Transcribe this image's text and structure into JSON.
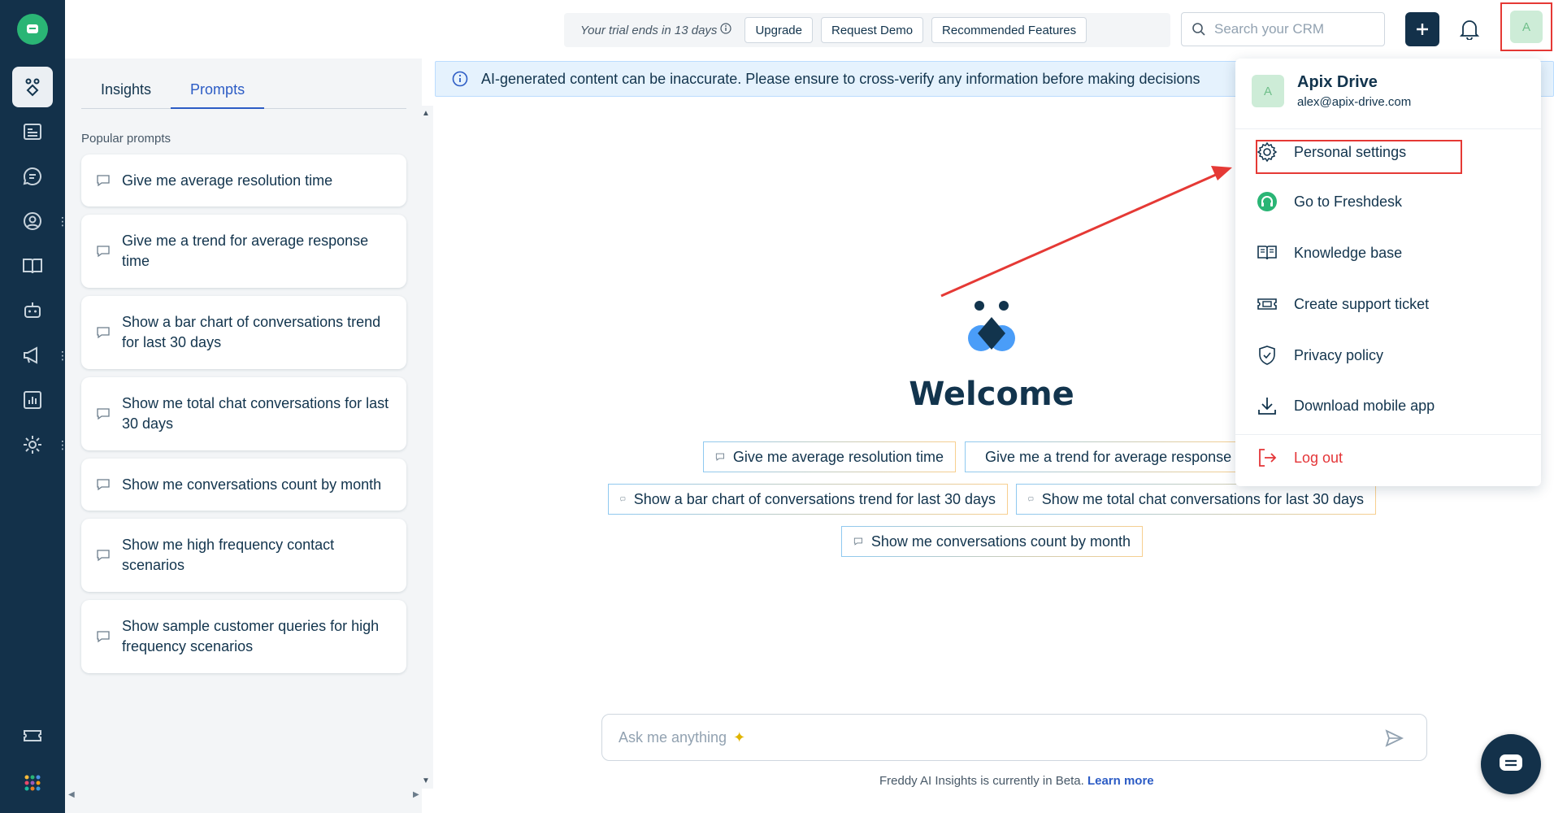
{
  "topbar": {
    "trial_text": "Your trial ends in 13 days",
    "upgrade_label": "Upgrade",
    "request_demo_label": "Request Demo",
    "recommended_label": "Recommended Features",
    "search_placeholder": "Search your CRM",
    "avatar_initial": "A"
  },
  "panel": {
    "tabs": [
      {
        "label": "Insights"
      },
      {
        "label": "Prompts"
      }
    ],
    "active_tab": "Prompts",
    "popular_heading": "Popular prompts",
    "prompts": [
      "Give me average resolution time",
      "Give me a trend for average response time",
      "Show a bar chart of conversations trend for last 30 days",
      "Show me total chat conversations for last 30 days",
      "Show me conversations count by month",
      "Show me high frequency contact scenarios",
      "Show sample customer queries for high frequency scenarios"
    ]
  },
  "banner": {
    "text": "AI-generated content can be inaccurate. Please ensure to cross-verify any information before making decisions"
  },
  "main": {
    "welcome": "Welcome",
    "chips": [
      "Give me average resolution time",
      "Give me a trend for average response",
      "Show a bar chart of conversations trend for last 30 days",
      "Show me total chat conversations for last 30 days",
      "Show me conversations count by month"
    ],
    "ask_placeholder": "Ask me anything",
    "beta_text": "Freddy AI Insights is currently in Beta.",
    "learn_more": "Learn more"
  },
  "dropdown": {
    "avatar_initial": "A",
    "name": "Apix Drive",
    "email": "alex@apix-drive.com",
    "items": [
      {
        "label": "Personal settings",
        "icon": "gear-icon"
      },
      {
        "label": "Go to Freshdesk",
        "icon": "freshdesk-icon"
      },
      {
        "label": "Knowledge base",
        "icon": "book-icon"
      },
      {
        "label": "Create support ticket",
        "icon": "ticket-icon"
      },
      {
        "label": "Privacy policy",
        "icon": "shield-icon"
      },
      {
        "label": "Download mobile app",
        "icon": "download-icon"
      }
    ],
    "logout_label": "Log out"
  },
  "colors": {
    "rail": "#13314a",
    "accent": "#2c5cc5",
    "annotation_red": "#e53935",
    "logout_red": "#e43538"
  }
}
